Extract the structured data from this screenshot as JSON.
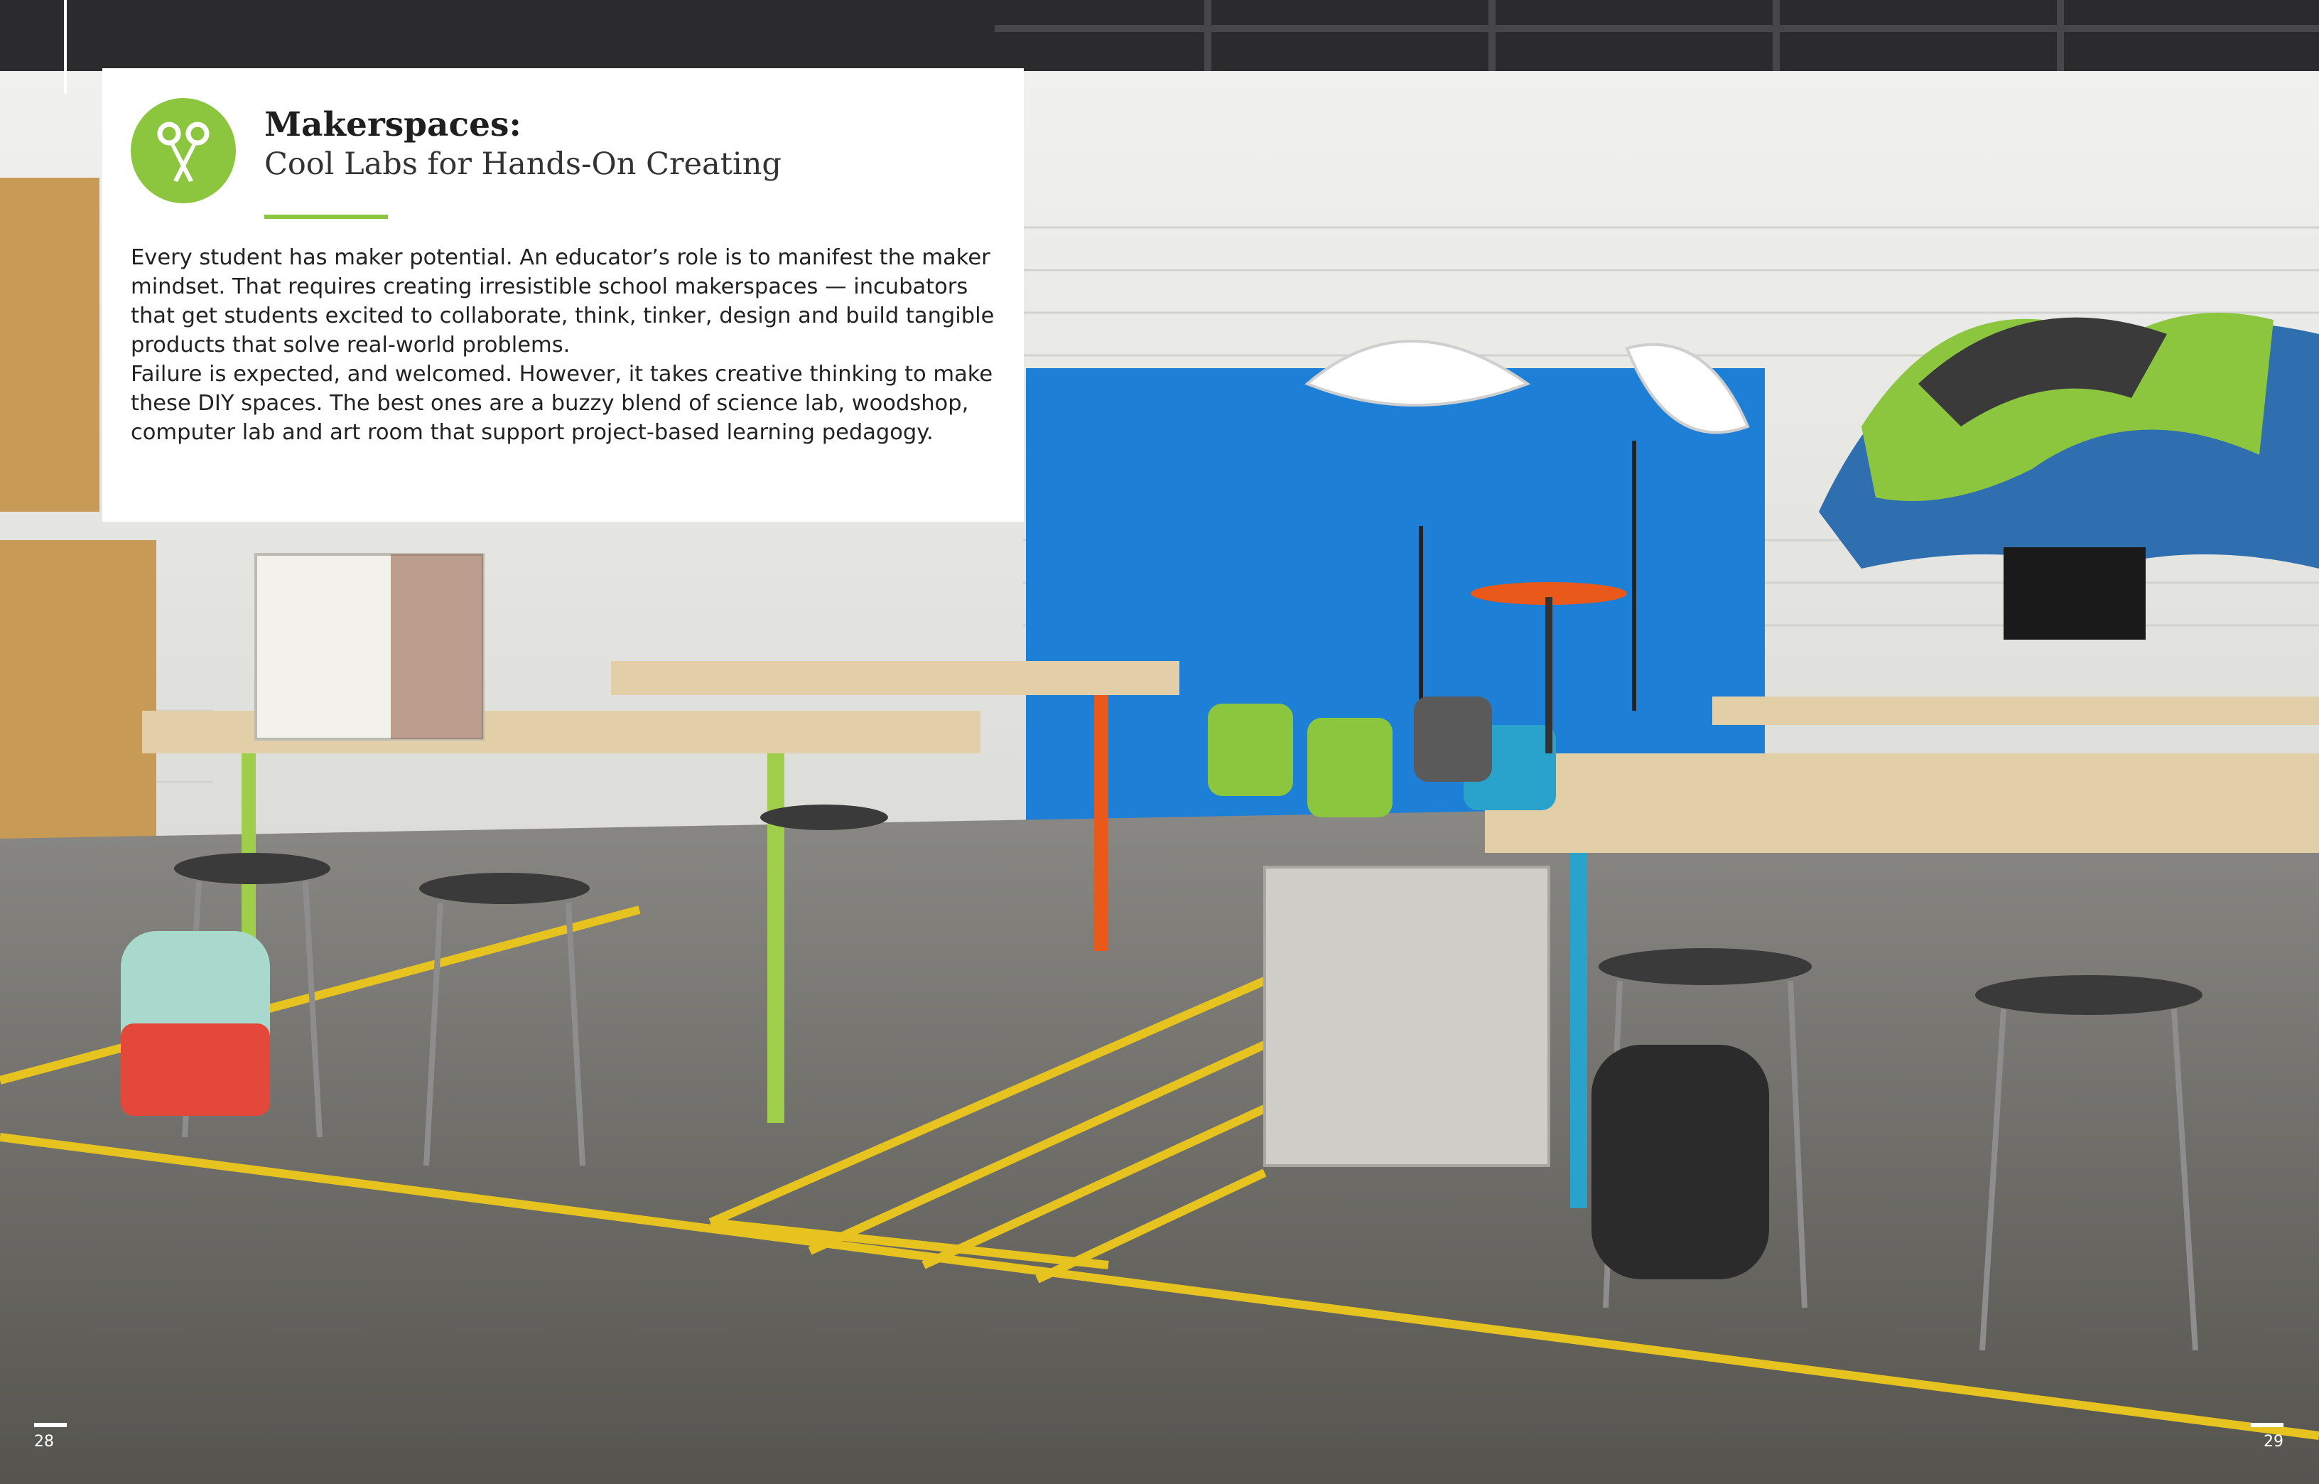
{
  "section": {
    "icon": "scissors-icon",
    "title": "Makerspaces:",
    "subtitle": "Cool Labs for Hands-On Creating",
    "accent_color": "#8cc63f"
  },
  "body": {
    "paragraph_1": "Every student has maker potential. An educator’s role is to manifest the maker mindset. That requires creating irresistible school makerspaces — incubators that get students excited to collaborate, think, tinker, design and build tangible products that solve real-world problems.",
    "paragraph_2": "Failure is expected, and welcomed. However, it takes creative thinking to make these DIY spaces. The best ones are a buzzy blend of science lab, woodshop, computer lab and art room that support project-based learning pedagogy."
  },
  "footer": {
    "page_left": "28",
    "page_right": "29"
  }
}
